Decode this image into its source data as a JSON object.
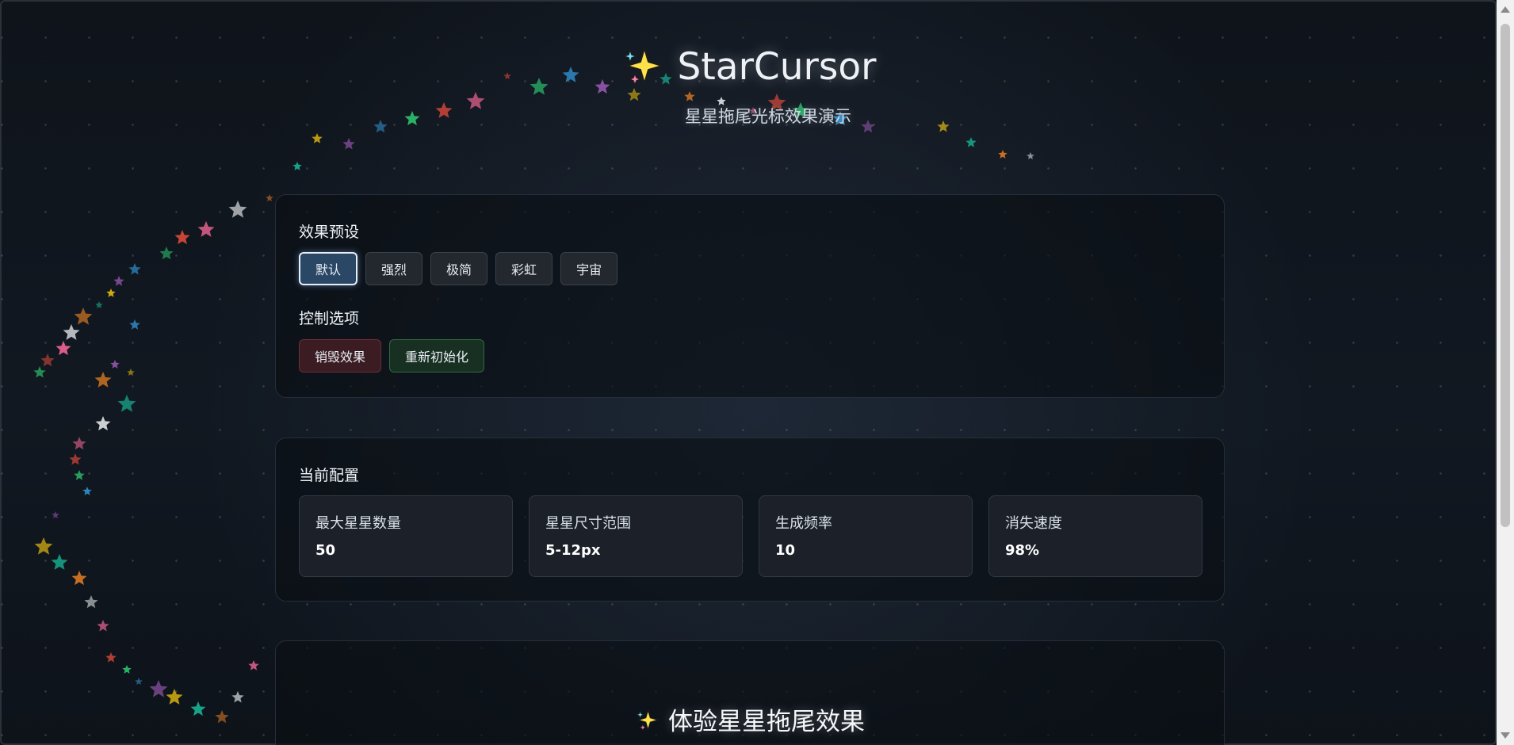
{
  "header": {
    "title": "StarCursor",
    "subtitle": "星星拖尾光标效果演示",
    "title_icon": "sparkles-icon"
  },
  "presets": {
    "title": "效果预设",
    "buttons": [
      "默认",
      "强烈",
      "极简",
      "彩虹",
      "宇宙"
    ],
    "active": "默认"
  },
  "controls": {
    "title": "控制选项",
    "destroy_label": "销毁效果",
    "reinit_label": "重新初始化"
  },
  "config": {
    "title": "当前配置",
    "items": [
      {
        "label": "最大星星数量",
        "value": "50"
      },
      {
        "label": "星星尺寸范围",
        "value": "5-12px"
      },
      {
        "label": "生成频率",
        "value": "10"
      },
      {
        "label": "消失速度",
        "value": "98%"
      }
    ]
  },
  "demo": {
    "title": "体验星星拖尾效果",
    "icon": "sparkles-icon"
  },
  "colors": {
    "background": "#0f141b",
    "card": "#0a0e14",
    "active_button": "#2a4765",
    "danger_button": "#3a1c22",
    "success_button": "#183022",
    "star_palette": [
      "#e74c3c",
      "#2ecc71",
      "#3498db",
      "#9b59b6",
      "#f1c40f",
      "#1abc9c",
      "#e67e22",
      "#ecf0f1",
      "#ff6b9d"
    ]
  }
}
